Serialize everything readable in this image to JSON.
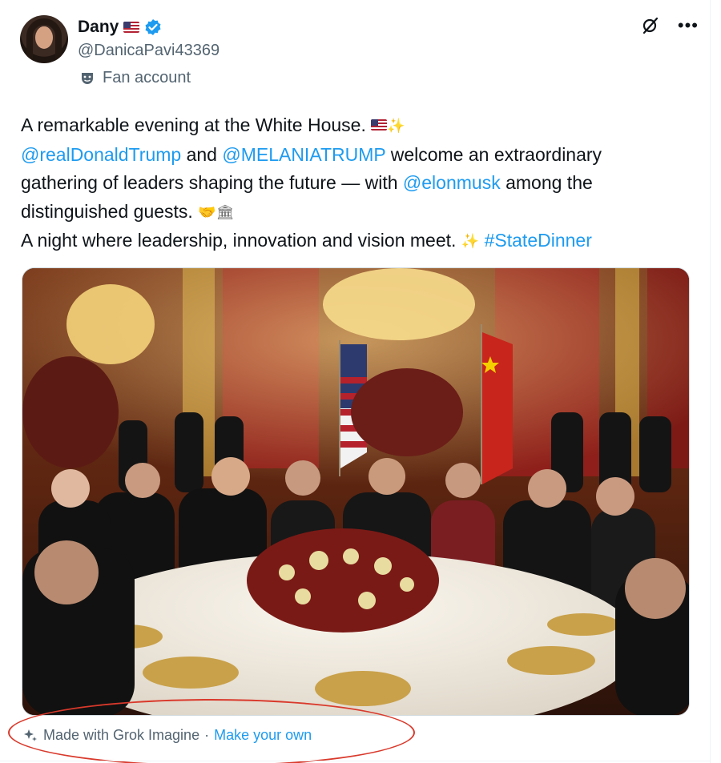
{
  "author": {
    "display_name": "Dany",
    "handle": "@DanicaPavi43369",
    "badge_label": "Fan account",
    "flag_icon": "us-flag-icon",
    "verified_color": "#1d9bf0"
  },
  "tweet": {
    "line1": "A remarkable evening at the White House.",
    "mention1": "@realDonaldTrump",
    "and_text": "and",
    "mention2": "@MELANIATRUMP",
    "line2_rest": "welcome an extraordinary",
    "line3_start": "gathering of leaders shaping the future — with",
    "mention3": "@elonmusk",
    "line3_end": "among the",
    "line4": "distinguished guests.",
    "line5": "A night where leadership, innovation and vision meet.",
    "hashtag": "#StateDinner"
  },
  "media": {
    "caption": "Made with Grok Imagine",
    "separator": "·",
    "make_link": "Make your own"
  },
  "colors": {
    "link": "#1d9bf0",
    "secondary_text": "#536471",
    "annotation_red": "#d9392b"
  }
}
